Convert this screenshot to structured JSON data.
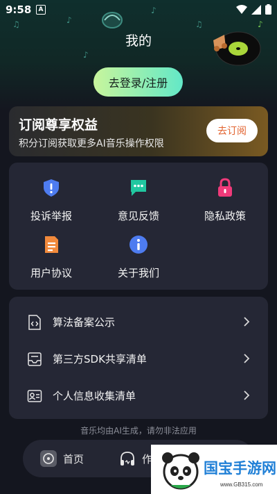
{
  "status_bar": {
    "time": "9:58",
    "notification": "A"
  },
  "header": {
    "title": "我的",
    "login_button": "去登录/注册"
  },
  "subscription": {
    "title": "订阅尊享权益",
    "description": "积分订阅获取更多AI音乐操作权限",
    "button": "去订阅"
  },
  "menu_grid": [
    {
      "label": "投诉举报",
      "icon": "shield-icon"
    },
    {
      "label": "意见反馈",
      "icon": "chat-icon"
    },
    {
      "label": "隐私政策",
      "icon": "lock-icon"
    },
    {
      "label": "用户协议",
      "icon": "document-icon"
    },
    {
      "label": "关于我们",
      "icon": "info-icon"
    }
  ],
  "menu_list": [
    {
      "label": "算法备案公示",
      "icon": "code-file-icon"
    },
    {
      "label": "第三方SDK共享清单",
      "icon": "inbox-icon"
    },
    {
      "label": "个人信息收集清单",
      "icon": "id-card-icon"
    }
  ],
  "footer_note": "音乐均由AI生成，请勿非法应用",
  "tabbar": [
    {
      "label": "首页",
      "icon": "home-disc-icon"
    },
    {
      "label": "作",
      "icon": "headphones-icon"
    }
  ],
  "watermark": {
    "text": "国宝手游网",
    "url": "www.GB315.com"
  },
  "colors": {
    "background": "#14161f",
    "card": "#252735",
    "accent_green": "#63e8c7",
    "subscribe_orange": "#e2622e"
  }
}
